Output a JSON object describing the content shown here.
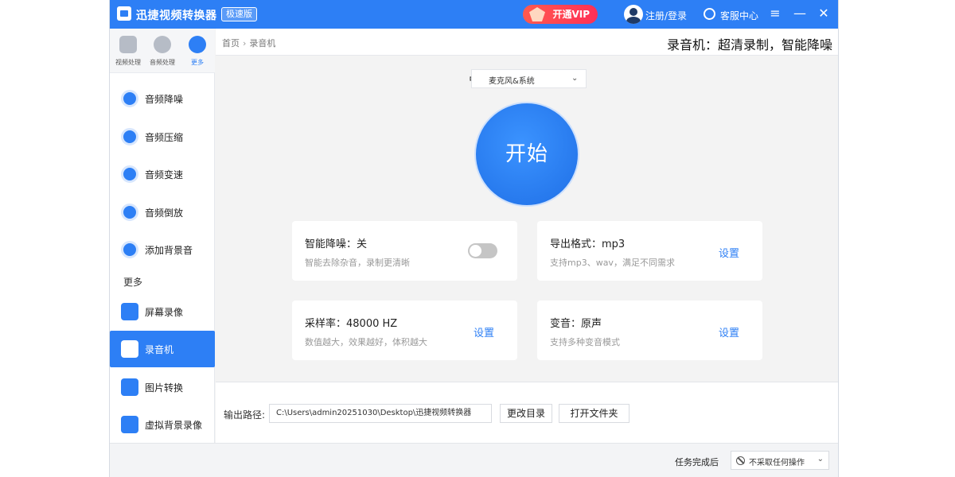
{
  "titlebar": {
    "app_title": "迅捷视频转换器",
    "edition_badge": "极速版",
    "vip_label": "开通VIP",
    "login_label": "注册/登录",
    "service_label": "客服中心",
    "menu_icon": "≡",
    "minimize_icon": "—",
    "close_icon": "✕"
  },
  "sidebar": {
    "categories": [
      {
        "label": "视频处理",
        "icon": "film-icon"
      },
      {
        "label": "音频处理",
        "icon": "audio-disc-icon"
      },
      {
        "label": "更多",
        "icon": "more-dots-icon"
      }
    ],
    "items": [
      {
        "label": "音频降噪",
        "icon": "audio-denoise-icon"
      },
      {
        "label": "音频压缩",
        "icon": "audio-compress-icon"
      },
      {
        "label": "音频变速",
        "icon": "audio-speed-icon"
      },
      {
        "label": "音频倒放",
        "icon": "audio-reverse-icon"
      },
      {
        "label": "添加背景音",
        "icon": "add-bgm-icon"
      }
    ],
    "section_label": "更多",
    "more_items": [
      {
        "label": "屏幕录像",
        "icon": "screen-record-icon"
      },
      {
        "label": "录音机",
        "icon": "recorder-icon"
      },
      {
        "label": "图片转换",
        "icon": "image-convert-icon"
      },
      {
        "label": "虚拟背景录像",
        "icon": "virtual-bg-icon"
      }
    ]
  },
  "header": {
    "breadcrumb_home": "首页",
    "breadcrumb_sep": "›",
    "breadcrumb_current": "录音机",
    "page_heading": "录音机：超清录制，智能降噪"
  },
  "main": {
    "audio_source": "麦克风&系统",
    "start_label": "开始",
    "cards": {
      "denoise": {
        "title": "智能降噪：关",
        "desc": "智能去除杂音，录制更清晰",
        "enabled": false
      },
      "format": {
        "title": "导出格式：mp3",
        "desc": "支持mp3、wav，满足不同需求",
        "button": "设置"
      },
      "samplerate": {
        "title": "采样率：48000 HZ",
        "desc": "数值越大，效果越好，体积越大",
        "button": "设置"
      },
      "voice": {
        "title": "变音：原声",
        "desc": "支持多种变音模式",
        "button": "设置"
      }
    }
  },
  "output": {
    "label": "输出路径:",
    "path": "C:\\Users\\admin20251030\\Desktop\\迅捷视频转换器",
    "change_dir_label": "更改目录",
    "open_folder_label": "打开文件夹"
  },
  "statusbar": {
    "after_task_label": "任务完成后",
    "after_task_value": "不采取任何操作"
  },
  "colors": {
    "accent": "#2d7ff5",
    "vip": "#ff3b52"
  }
}
